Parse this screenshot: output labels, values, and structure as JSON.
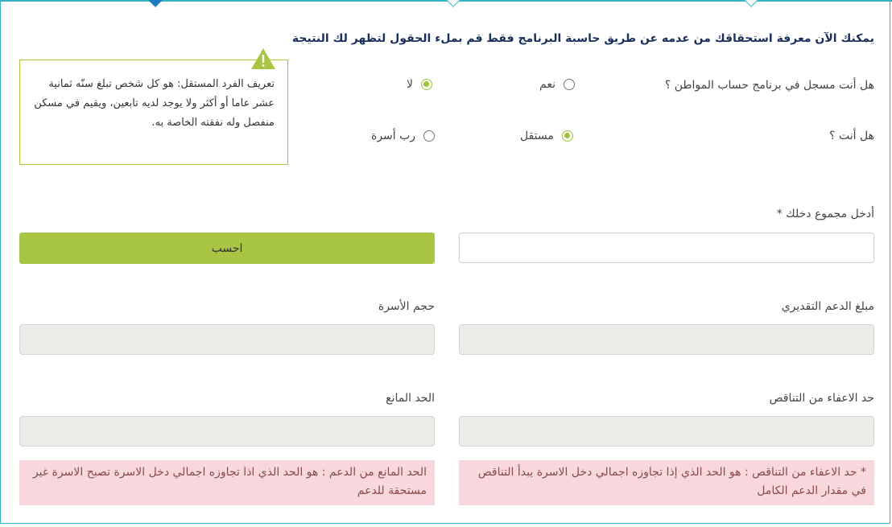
{
  "intro": "يمكنك الآن معرفة استحقاقك من عدمه عن طريق حاسبة البرنامج فقط قم بملء الحقول لتظهر لك النتيجة",
  "registered": {
    "question": "هل أنت مسجل في برنامج حساب المواطن ؟",
    "options": [
      {
        "label": "نعم",
        "selected": false
      },
      {
        "label": "لا",
        "selected": true
      }
    ]
  },
  "status": {
    "question": "هل أنت ؟",
    "options": [
      {
        "label": "مستقل",
        "selected": true
      },
      {
        "label": "رب أسرة",
        "selected": false
      }
    ]
  },
  "tooltip": {
    "icon": "warning-icon",
    "text": "تعريف الفرد المستقل: هو كل شخص تبلغ سنّه ثمانية عشر عاما أو أكثر ولا يوجد لديه تابعين، ويقيم في مسكن منفصل وله نفقته الخاصة به."
  },
  "income": {
    "label": "أدخل مجموع دخلك *",
    "value": ""
  },
  "calculate_label": "احسب",
  "support_amount": {
    "label": "مبلغ الدعم التقديري",
    "value": ""
  },
  "family_size": {
    "label": "حجم الأسرة",
    "value": ""
  },
  "exemption_limit": {
    "label": "حد الاعفاء من التناقص",
    "value": ""
  },
  "max_limit": {
    "label": "الحد المانع",
    "value": ""
  },
  "notes": {
    "exemption": "* حد الاعفاء من التناقص : هو الحد الذي إذا تجاوزه اجمالي دخل الاسرة يبدأ التناقص في مقدار الدعم الكامل",
    "max_limit": "الحد المانع من الدعم : هو الحد الذي اذا تجاوزه اجمالي دخل الاسرة تصبح الاسرة غير مستحقة للدعم"
  },
  "colors": {
    "accent": "#a8c544",
    "teal": "#35b3c4",
    "heading": "#1a2f5e",
    "note_bg": "#f8d8dc"
  }
}
